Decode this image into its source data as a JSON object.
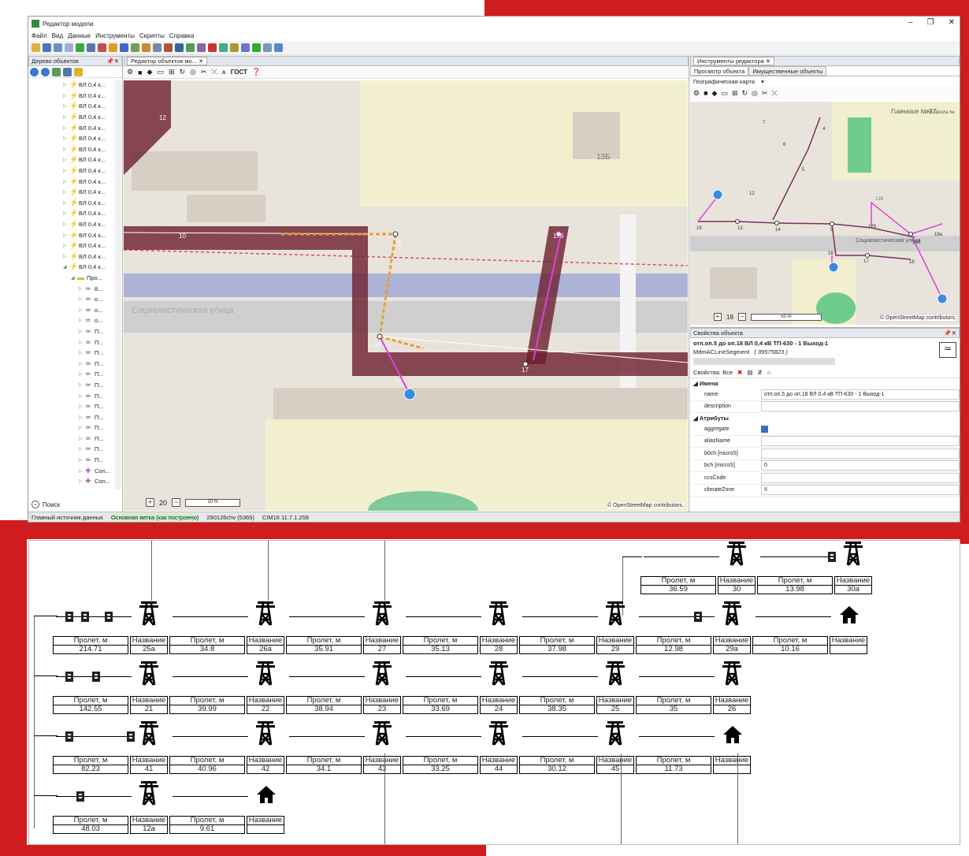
{
  "app": {
    "title": "Редактор модели",
    "menu": [
      "Файл",
      "Вид",
      "Данные",
      "Инструменты",
      "Скрипты",
      "Справка"
    ]
  },
  "tree_panel": {
    "title": "Дерево объектов",
    "items": [
      "ВЛ 0,4 к...",
      "ВЛ 0,4 к...",
      "ВЛ 0,4 к...",
      "ВЛ 0,4 к...",
      "ВЛ 0,4 к...",
      "ВЛ 0,4 к...",
      "ВЛ 0,4 к...",
      "ВЛ 0,4 к...",
      "ВЛ 0,4 к...",
      "ВЛ 0,4 к...",
      "ВЛ 0,4 к...",
      "ВЛ 0,4 к...",
      "ВЛ 0,4 к...",
      "ВЛ 0,4 к...",
      "ВЛ 0,4 к...",
      "ВЛ 0,4 к...",
      "ВЛ 0,4 к...",
      "ВЛ 0,4 к...",
      "Про...",
      "8...",
      "о...",
      "о...",
      "о...",
      "П...",
      "П...",
      "П...",
      "П...",
      "П...",
      "П...",
      "П...",
      "П...",
      "П...",
      "П...",
      "П...",
      "П...",
      "П...",
      "Con...",
      "Con..."
    ],
    "search_label": "Поиск"
  },
  "editor": {
    "tab_label": "Редактор объектов мо...",
    "gost_label": "ГОСТ",
    "zoom": "20",
    "scale_label": "10 m",
    "street_label": "Социалистическая улица",
    "building_label": "13Б",
    "attribution": "© OpenStreetMap contributors.",
    "map_labels": [
      "12",
      "10",
      "5",
      "16",
      "17",
      "17б"
    ]
  },
  "tools": {
    "panel_title": "Инструменты редактора",
    "tab_view": "Просмотр объекта",
    "tab_property": "Имущественные объекты",
    "map_select": "Географическая карта",
    "mini_zoom": "18",
    "mini_scale": "50 m",
    "mini_attribution": "© OpenStreetMap contributors.",
    "mini_labels": [
      "Гимназия № 37",
      "ЯК Школа №",
      "13б",
      "Социалистическая улица",
      "12",
      "13",
      "14",
      "5",
      "17б",
      "18",
      "16",
      "17",
      "18а",
      "18б",
      "19",
      "7",
      "6",
      "4",
      "5"
    ]
  },
  "properties": {
    "panel_title": "Свойства объекта",
    "object_name": "отп.оп.5 до оп.18 ВЛ 0,4 кВ ТП-630 - 1 Выход-1",
    "object_type": "MdmACLineSegment",
    "object_id": "( 39575823 )",
    "filter_label": "Свойства: Все",
    "group_names": "Имена",
    "group_attrs": "Атрибуты",
    "rows": [
      {
        "key": "name",
        "value": "отп.оп.5 до оп.18 ВЛ 0,4 кВ ТП-630 - 1 Выход-1"
      },
      {
        "key": "description",
        "value": ""
      },
      {
        "key": "aggregate",
        "value": ""
      },
      {
        "key": "aliasName",
        "value": ""
      },
      {
        "key": "b0ch [microS]",
        "value": ""
      },
      {
        "key": "bch [microS]",
        "value": "0"
      },
      {
        "key": "ccsCode",
        "value": ""
      },
      {
        "key": "climateZone",
        "value": "II"
      }
    ]
  },
  "statusbar": {
    "source": "Главный источник данных",
    "branch": "Основная ветка (как построено)",
    "file": "290126chv (5365)",
    "version": "CIM16 11.7.1.258"
  },
  "diagram": {
    "span_header": "Пролет, м",
    "name_header": "Название",
    "rows": [
      {
        "spans": [
          "36.59",
          "13.98"
        ],
        "names": [
          "30",
          "30a"
        ]
      },
      {
        "spans": [
          "214.71",
          "34.8",
          "35.91",
          "35.13",
          "37.98",
          "12.98",
          "10.16"
        ],
        "names": [
          "25a",
          "26a",
          "27",
          "28",
          "29",
          "29a",
          ""
        ]
      },
      {
        "spans": [
          "142.55",
          "39.99",
          "38.94",
          "33.69",
          "38.35",
          "35"
        ],
        "names": [
          "21",
          "22",
          "23",
          "24",
          "25",
          "26"
        ]
      },
      {
        "spans": [
          "82.23",
          "40.96",
          "34.1",
          "33.25",
          "30.12",
          "11.73"
        ],
        "names": [
          "41",
          "42",
          "43",
          "44",
          "45",
          ""
        ]
      },
      {
        "spans": [
          "48.03",
          "9.61"
        ],
        "names": [
          "12a",
          ""
        ]
      }
    ]
  }
}
